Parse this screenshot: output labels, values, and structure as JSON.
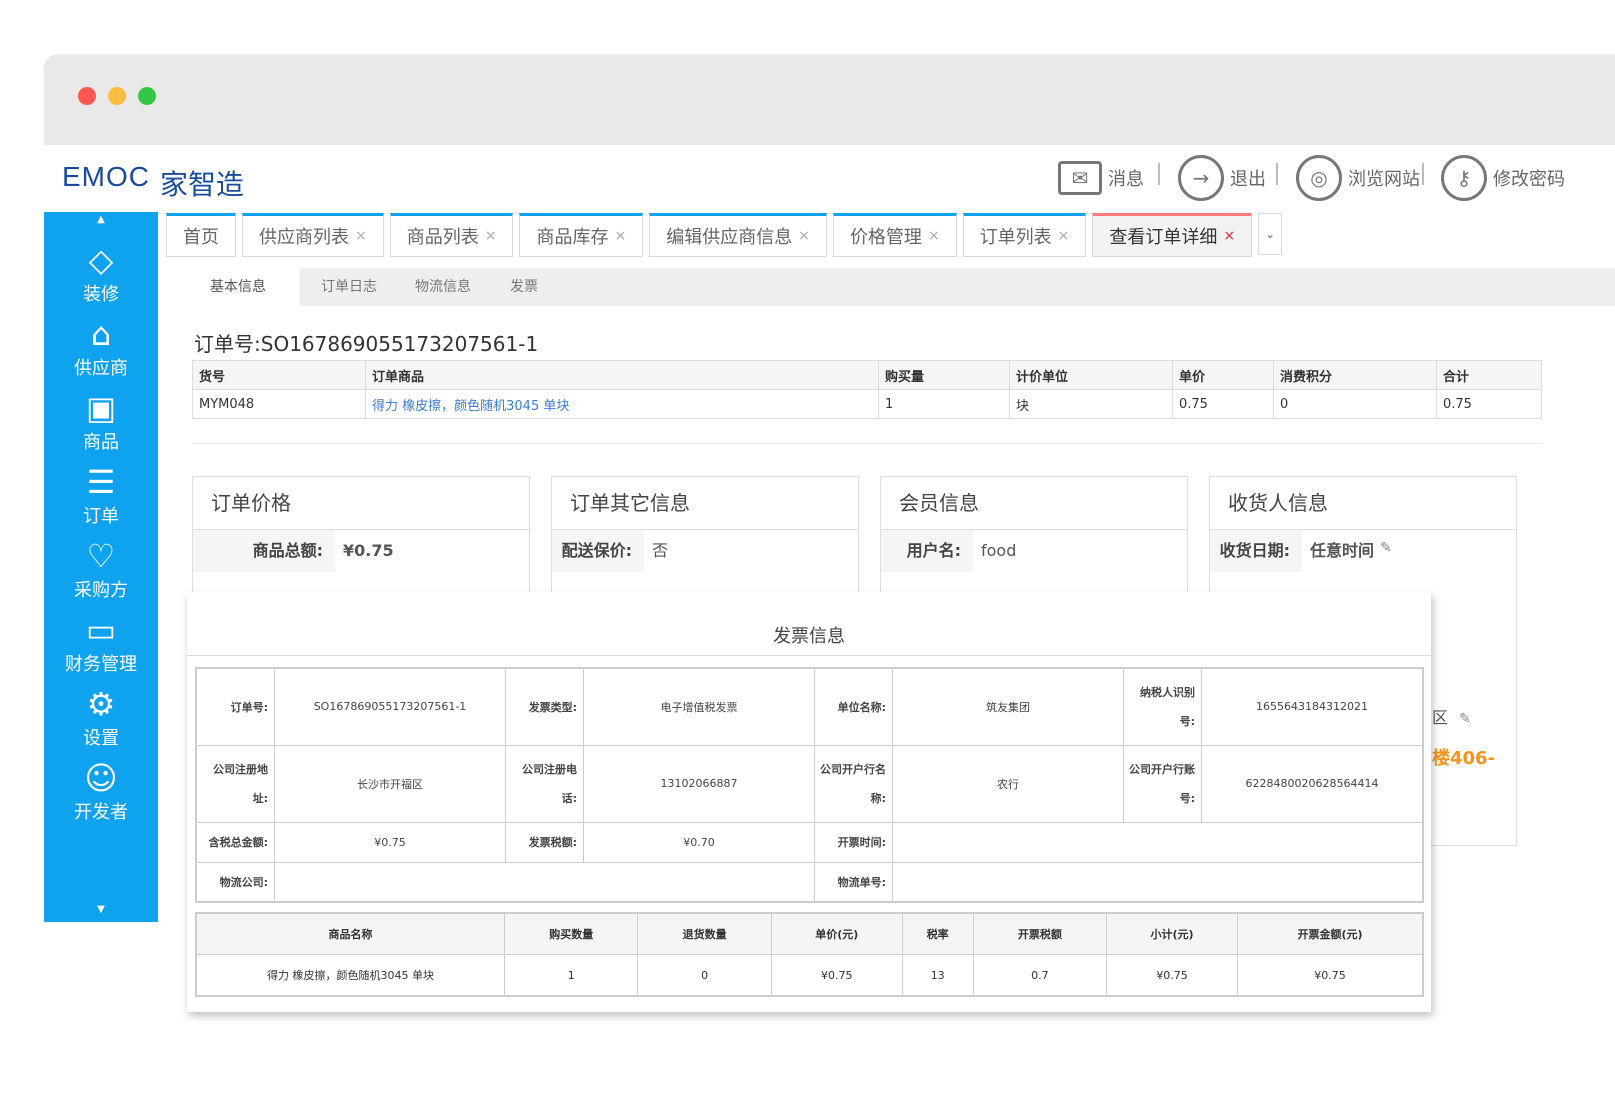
{
  "brand": {
    "logo": "EMOC",
    "name": "家智造"
  },
  "header_nav": [
    {
      "icon": "mail-icon",
      "label": "消息"
    },
    {
      "icon": "logout-icon",
      "label": "退出"
    },
    {
      "icon": "globe-icon",
      "label": "浏览网站"
    },
    {
      "icon": "key-icon",
      "label": "修改密码"
    }
  ],
  "sidebar": {
    "items": [
      {
        "icon": "tag-icon",
        "label": "装修"
      },
      {
        "icon": "store-icon",
        "label": "供应商"
      },
      {
        "icon": "bag-icon",
        "label": "商品"
      },
      {
        "icon": "list-icon",
        "label": "订单"
      },
      {
        "icon": "heart-icon",
        "label": "采购方"
      },
      {
        "icon": "monitor-icon",
        "label": "财务管理"
      },
      {
        "icon": "gear-icon",
        "label": "设置"
      },
      {
        "icon": "user-icon",
        "label": "开发者"
      }
    ]
  },
  "tabs": [
    "首页",
    "供应商列表",
    "商品列表",
    "商品库存",
    "编辑供应商信息",
    "价格管理",
    "订单列表",
    "查看订单详细"
  ],
  "subtabs": [
    "基本信息",
    "订单日志",
    "物流信息",
    "发票"
  ],
  "order": {
    "label": "订单号:",
    "number": "SO167869055173207561-1",
    "columns": [
      "货号",
      "订单商品",
      "购买量",
      "计价单位",
      "单价",
      "消费积分",
      "合计"
    ],
    "rows": [
      [
        "MYM048",
        "得力 橡皮擦，颜色随机3045 单块",
        "1",
        "块",
        "0.75",
        "0",
        "0.75"
      ]
    ]
  },
  "panels": {
    "price": {
      "title": "订单价格",
      "key": "商品总额:",
      "value": "¥0.75"
    },
    "other": {
      "title": "订单其它信息",
      "key": "配送保价:",
      "value": "否"
    },
    "member": {
      "title": "会员信息",
      "key": "用户名:",
      "value": "food"
    },
    "receiver": {
      "title": "收货人信息",
      "key": "收货日期:",
      "value": "任意时间",
      "partial1": "区",
      "partial2": "楼406-"
    }
  },
  "invoice": {
    "title": "发票信息",
    "fields": {
      "order_no_k": "订单号:",
      "order_no_v": "SO167869055173207561-1",
      "type_k": "发票类型:",
      "type_v": "电子增值税发票",
      "unit_k": "单位名称:",
      "unit_v": "筑友集团",
      "tax_id_k1": "纳税人识别",
      "tax_id_k2": "号:",
      "tax_id_v": "1655643184312021",
      "addr_k1": "公司注册地",
      "addr_k2": "址:",
      "addr_v": "长沙市开福区",
      "tel_k1": "公司注册电",
      "tel_k2": "话:",
      "tel_v": "13102066887",
      "bank_k1": "公司开户行名",
      "bank_k2": "称:",
      "bank_v": "农行",
      "acct_k1": "公司开户行账",
      "acct_k2": "号:",
      "acct_v": "6228480020628564414",
      "total_k": "含税总金额:",
      "total_v": "¥0.75",
      "tax_k": "发票税额:",
      "tax_v": "¥0.70",
      "time_k": "开票时间:",
      "time_v": "",
      "logi_k": "物流公司:",
      "logi_v": "",
      "logino_k": "物流单号:",
      "logino_v": ""
    },
    "goods_columns": [
      "商品名称",
      "购买数量",
      "退货数量",
      "单价(元)",
      "税率",
      "开票税额",
      "小计(元)",
      "开票金额(元)"
    ],
    "goods_rows": [
      [
        "得力 橡皮擦，颜色随机3045 单块",
        "1",
        "0",
        "¥0.75",
        "13",
        "0.7",
        "¥0.75",
        "¥0.75"
      ]
    ]
  }
}
